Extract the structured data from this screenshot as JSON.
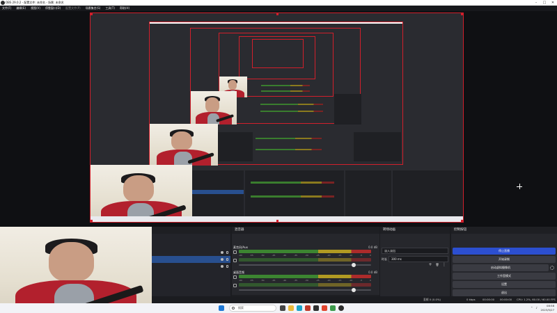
{
  "window": {
    "title": "OBS 29.0.2 - 配置文件: 未命名 - 场景: 未命名",
    "controls": [
      "–",
      "□",
      "✕"
    ]
  },
  "menu": {
    "items": [
      "文件(F)",
      "编辑(E)",
      "视图(V)",
      "停靠窗口(D)",
      "配置文件(P)",
      "场景集合(S)",
      "工具(T)",
      "帮助(H)"
    ]
  },
  "sources": {
    "header": "",
    "items": [
      {
        "label": "",
        "selected": false
      },
      {
        "label": "",
        "selected": true
      },
      {
        "label": "",
        "selected": false
      }
    ]
  },
  "mixer": {
    "header": "混音器",
    "channels": [
      {
        "name": "麦克风/Aux",
        "db": "0.0 dB",
        "scale": [
          "-60",
          "-55",
          "-50",
          "-45",
          "-40",
          "-35",
          "-30",
          "-25",
          "-20",
          "-15",
          "-10",
          "-5",
          "0"
        ]
      },
      {
        "name": "桌面音频",
        "db": "0.0 dB",
        "scale": [
          "-60",
          "-55",
          "-50",
          "-45",
          "-40",
          "-35",
          "-30",
          "-25",
          "-20",
          "-15",
          "-10",
          "-5",
          "0"
        ]
      }
    ]
  },
  "transitions": {
    "header": "转场动画",
    "type": "淡入淡出",
    "duration_label": "时长",
    "duration": "300 ms",
    "add": "+",
    "remove": "🗑",
    "more": "⋮"
  },
  "controls": {
    "header": "控制按钮",
    "buttons": [
      "停止直播",
      "开始录制",
      "启动虚拟摄像机",
      "工作室模式",
      "设置",
      "退出"
    ]
  },
  "status": {
    "dropped": "丢帧 0 (0.0%)",
    "bitrate": "0 kbps",
    "live_time": "00:00:00",
    "rec_time": "00:00:00",
    "cpu": "CPU: 1.2%, 60.00 / 60.00 FPS"
  },
  "taskbar": {
    "search_placeholder": "搜索",
    "time": "08:58",
    "date": "2023/5/27"
  },
  "colors": {
    "accent_red": "#d21f2b",
    "primary_blue": "#2c4fd0",
    "selected_row": "#284f8f"
  }
}
